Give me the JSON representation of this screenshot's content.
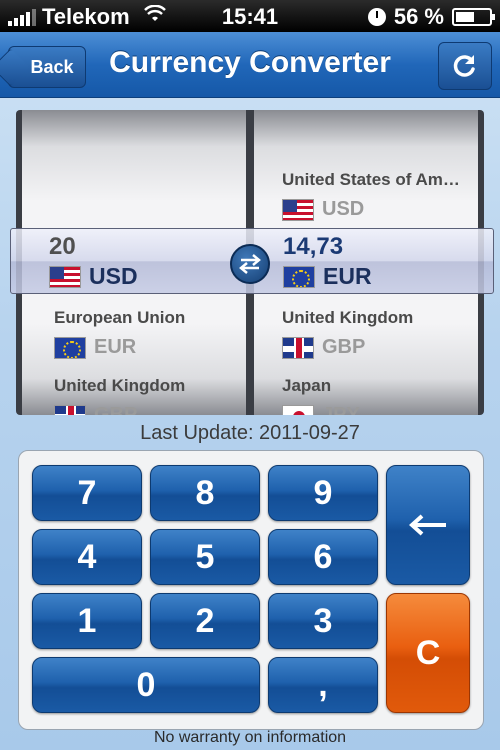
{
  "status_bar": {
    "carrier": "Telekom",
    "time": "15:41",
    "battery": "56 %",
    "battery_level": 0.56,
    "signal_icon": "signal-bars-icon",
    "wifi_icon": "wifi-icon",
    "clock_icon": "clock-icon",
    "battery_icon": "battery-icon"
  },
  "nav": {
    "back_label": "Back",
    "title": "Currency Converter",
    "refresh_icon": "refresh-icon"
  },
  "picker": {
    "left": {
      "selected_value": "20",
      "selected_code": "USD",
      "rows_below": [
        {
          "country": "European Union",
          "code": "EUR",
          "flag": "eu"
        },
        {
          "country": "United Kingdom",
          "code": "GBP",
          "flag": "gb"
        }
      ]
    },
    "right": {
      "row_above": {
        "country": "United States of Am…",
        "code": "USD",
        "flag": "us"
      },
      "selected_value": "14,73",
      "selected_code": "EUR",
      "rows_below": [
        {
          "country": "United Kingdom",
          "code": "GBP",
          "flag": "gb"
        },
        {
          "country": "Japan",
          "code": "JPY",
          "flag": "jp"
        }
      ]
    },
    "swap_icon": "swap-arrows-icon"
  },
  "last_update": "Last Update: 2011-09-27",
  "keypad": {
    "keys": [
      "7",
      "8",
      "9",
      "4",
      "5",
      "6",
      "1",
      "2",
      "3",
      "0",
      ","
    ],
    "backspace": "←",
    "clear": "C"
  },
  "footer": "No warranty on information",
  "colors": {
    "nav_blue": "#2167b9",
    "key_blue": "#1f61ad",
    "clear_orange": "#e95f10"
  }
}
